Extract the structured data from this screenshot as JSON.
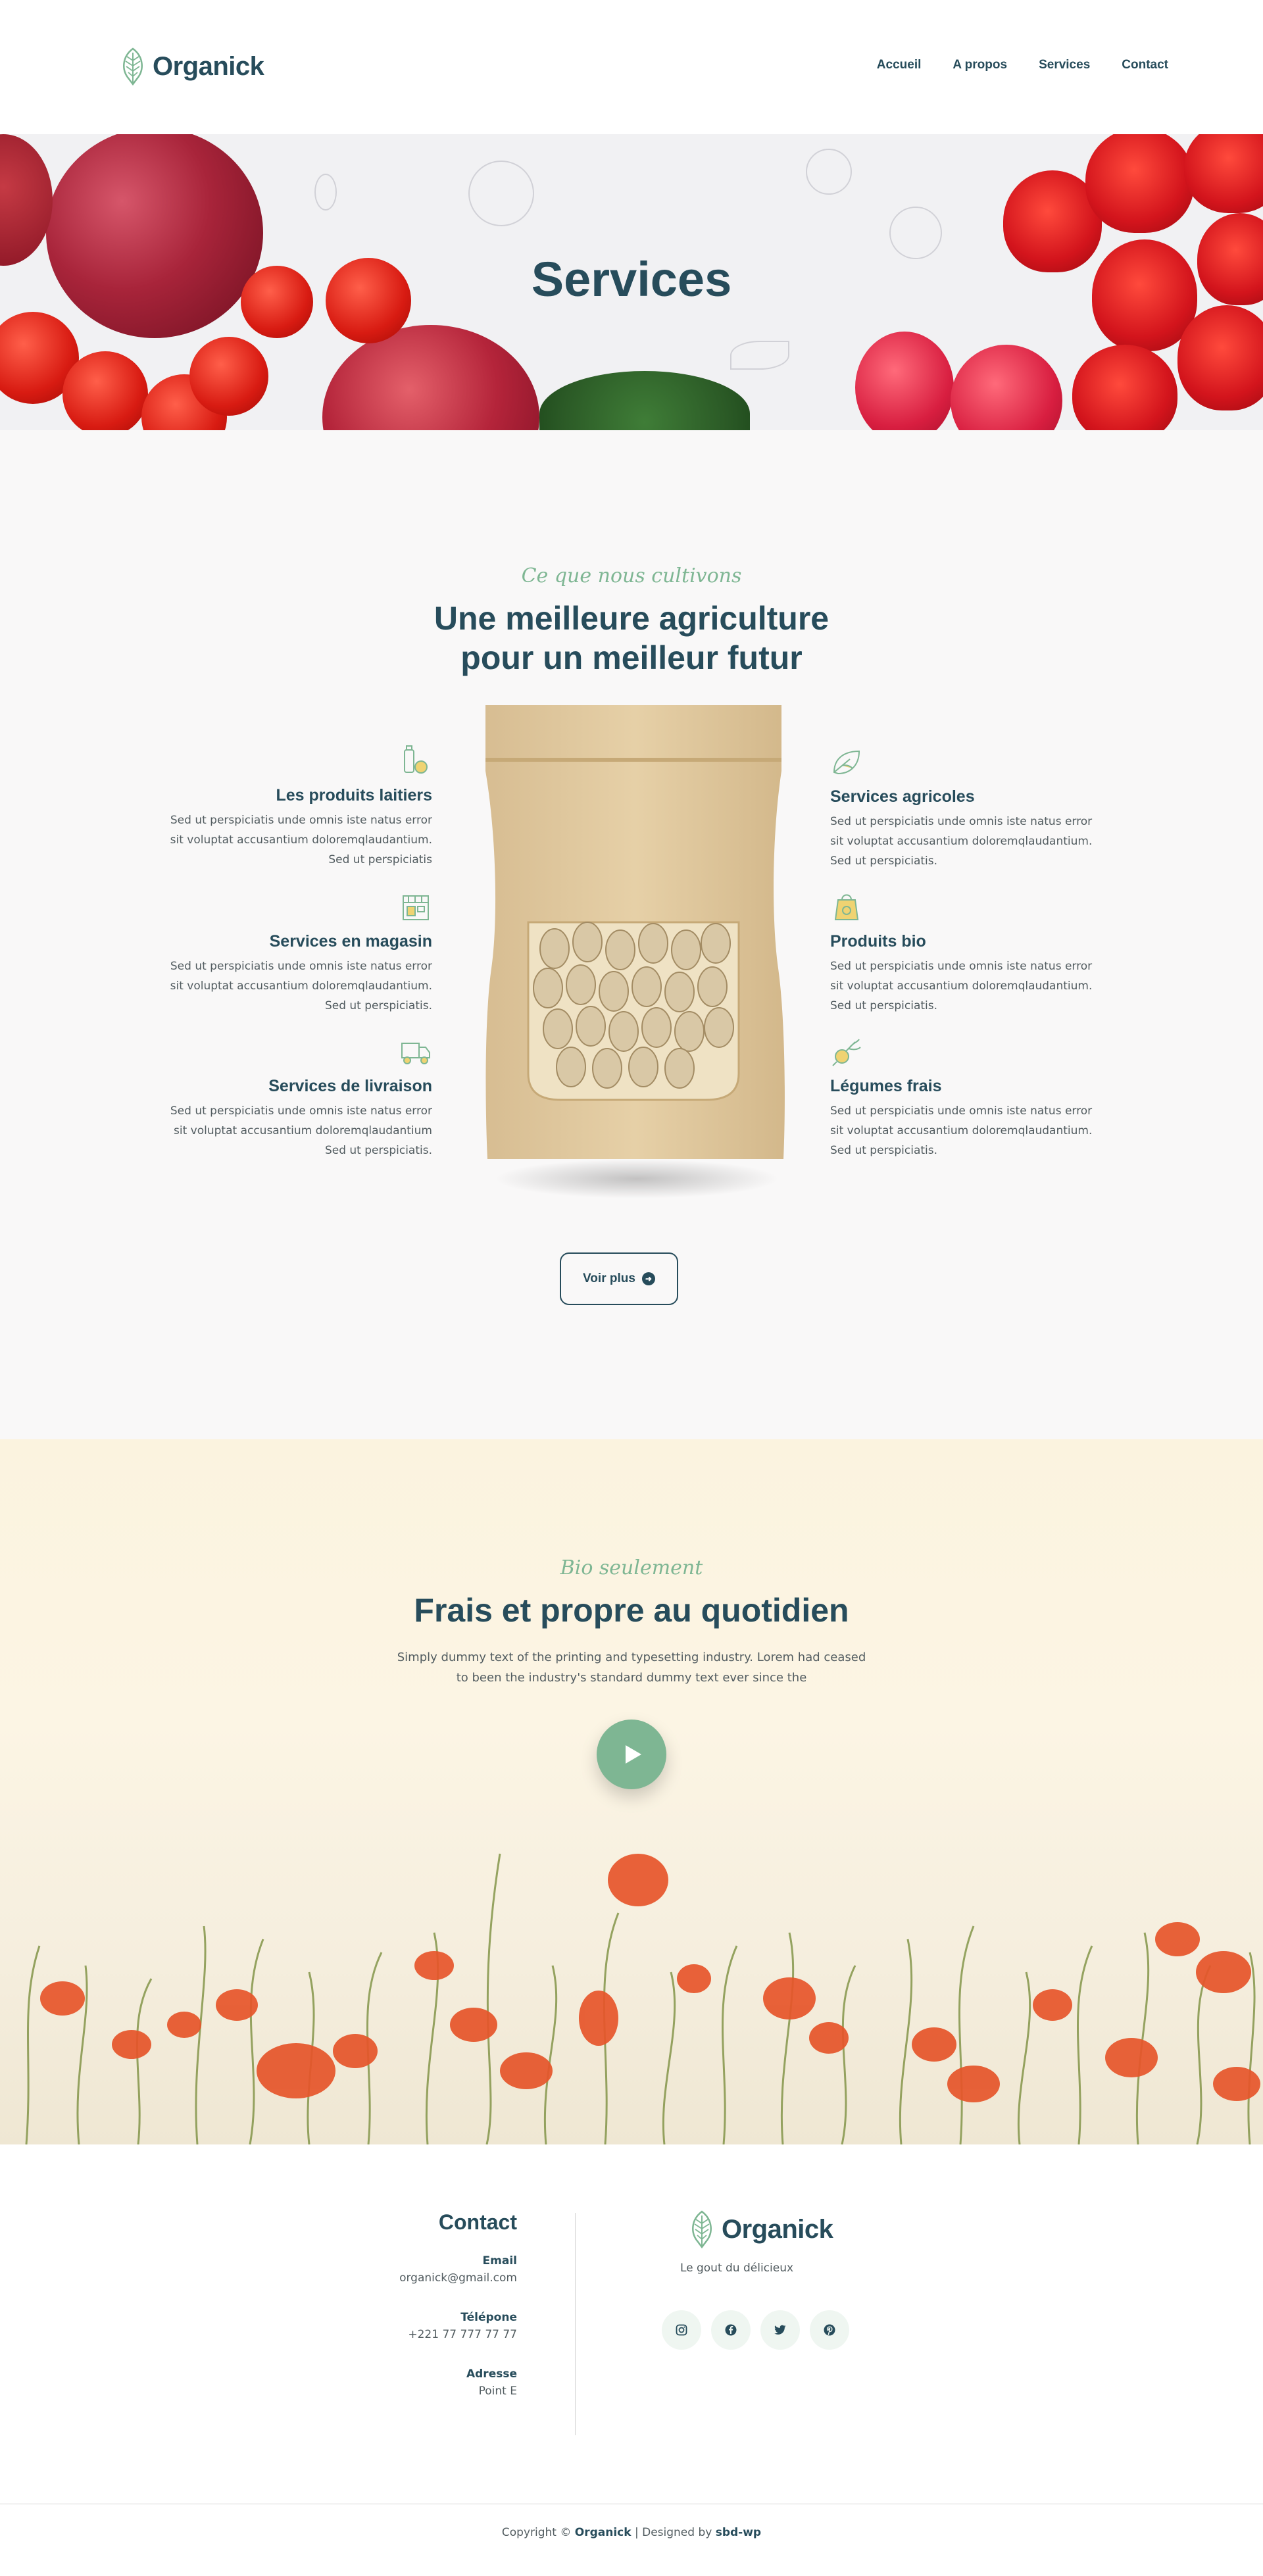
{
  "header": {
    "logo_text": "Organick",
    "nav": [
      "Accueil",
      "A propos",
      "Services",
      "Contact"
    ]
  },
  "hero": {
    "title": "Services"
  },
  "services": {
    "script_subtitle": "Ce que nous cultivons",
    "heading_line1": "Une meilleure agriculture",
    "heading_line2": "pour un meilleur futur",
    "left": [
      {
        "title": "Les produits laitiers",
        "text": "Sed ut perspiciatis unde omnis iste natus error sit voluptat accusantium doloremqlaudantium. Sed ut perspiciatis",
        "icon": "dairy-icon"
      },
      {
        "title": "Services en magasin",
        "text": "Sed ut perspiciatis unde omnis iste natus error sit voluptat accusantium doloremqlaudantium. Sed ut perspiciatis.",
        "icon": "store-icon"
      },
      {
        "title": "Services de livraison",
        "text": "Sed ut perspiciatis unde omnis iste natus error sit voluptat accusantium doloremqlaudantium Sed ut perspiciatis.",
        "icon": "delivery-truck-icon"
      }
    ],
    "right": [
      {
        "title": "Services agricoles",
        "text": "Sed ut perspiciatis unde omnis iste natus error sit voluptat accusantium doloremqlaudantium. Sed ut perspiciatis.",
        "icon": "leaf-icon"
      },
      {
        "title": "Produits bio",
        "text": "Sed ut perspiciatis unde omnis iste natus error sit voluptat accusantium doloremqlaudantium. Sed ut perspiciatis.",
        "icon": "organic-bag-icon"
      },
      {
        "title": "Légumes frais",
        "text": "Sed ut perspiciatis unde omnis iste natus error sit voluptat accusantium doloremqlaudantium. Sed ut perspiciatis.",
        "icon": "radish-icon"
      }
    ],
    "button_label": "Voir plus"
  },
  "fresh": {
    "script_subtitle": "Bio seulement",
    "heading": "Frais et propre au quotidien",
    "text_line1": "Simply dummy text of the printing and typesetting industry. Lorem had ceased",
    "text_line2": "to been the industry's standard dummy text ever since the"
  },
  "footer": {
    "contact_title": "Contact",
    "email_label": "Email",
    "email_value": "organick@gmail.com",
    "phone_label": "Télépone",
    "phone_value": "+221 77 777 77 77",
    "address_label": "Adresse",
    "address_value": "Point E",
    "logo_text": "Organick",
    "tagline": "Le gout du délicieux",
    "socials": [
      "instagram-icon",
      "facebook-icon",
      "twitter-icon",
      "pinterest-icon"
    ],
    "copyright_prefix": "Copyright © ",
    "copyright_brand": "Organick",
    "copyright_mid": " | Designed by ",
    "copyright_designer": "sbd-wp"
  },
  "colors": {
    "primary": "#274c5b",
    "accent_green": "#7eb693",
    "accent_yellow": "#efd372",
    "body_text": "#525c60"
  }
}
